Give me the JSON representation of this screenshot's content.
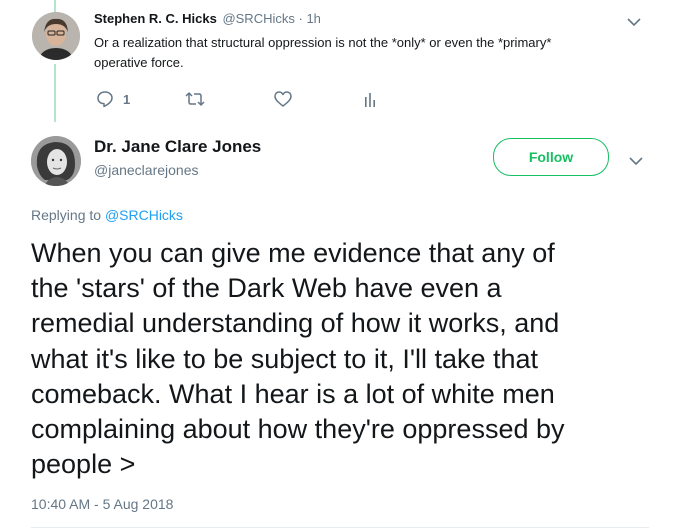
{
  "reply_tweet": {
    "author_name": "Stephen R. C. Hicks",
    "author_handle": "@SRCHicks",
    "separator": "·",
    "time": "1h",
    "text_line1": "Or a realization that structural oppression is not the *only* or even the *primary*",
    "text_line2": "operative force.",
    "reply_count": "1",
    "icons": [
      "reply-icon",
      "retweet-icon",
      "like-icon",
      "analytics-icon",
      "chevron-down-icon"
    ]
  },
  "main_tweet": {
    "author_name": "Dr. Jane Clare Jones",
    "author_handle": "@janeclarejones",
    "follow_label": "Follow",
    "replying_to_label": "Replying to",
    "replying_to_handle": "@SRCHicks",
    "text_lines": [
      "When you can give me evidence that any of",
      "the 'stars' of the Dark Web have even a",
      "remedial understanding of how it works, and",
      "what it's like to be subject to it, I'll take that",
      "comeback. What I hear is a lot of white men",
      "complaining about how they're oppressed by",
      "people >"
    ],
    "timestamp": "10:40 AM - 5 Aug 2018"
  },
  "colors": {
    "follow_green": "#17bf63",
    "link_blue": "#1da1f2",
    "muted_gray": "#657786",
    "thread_line": "#b4e5cf"
  }
}
